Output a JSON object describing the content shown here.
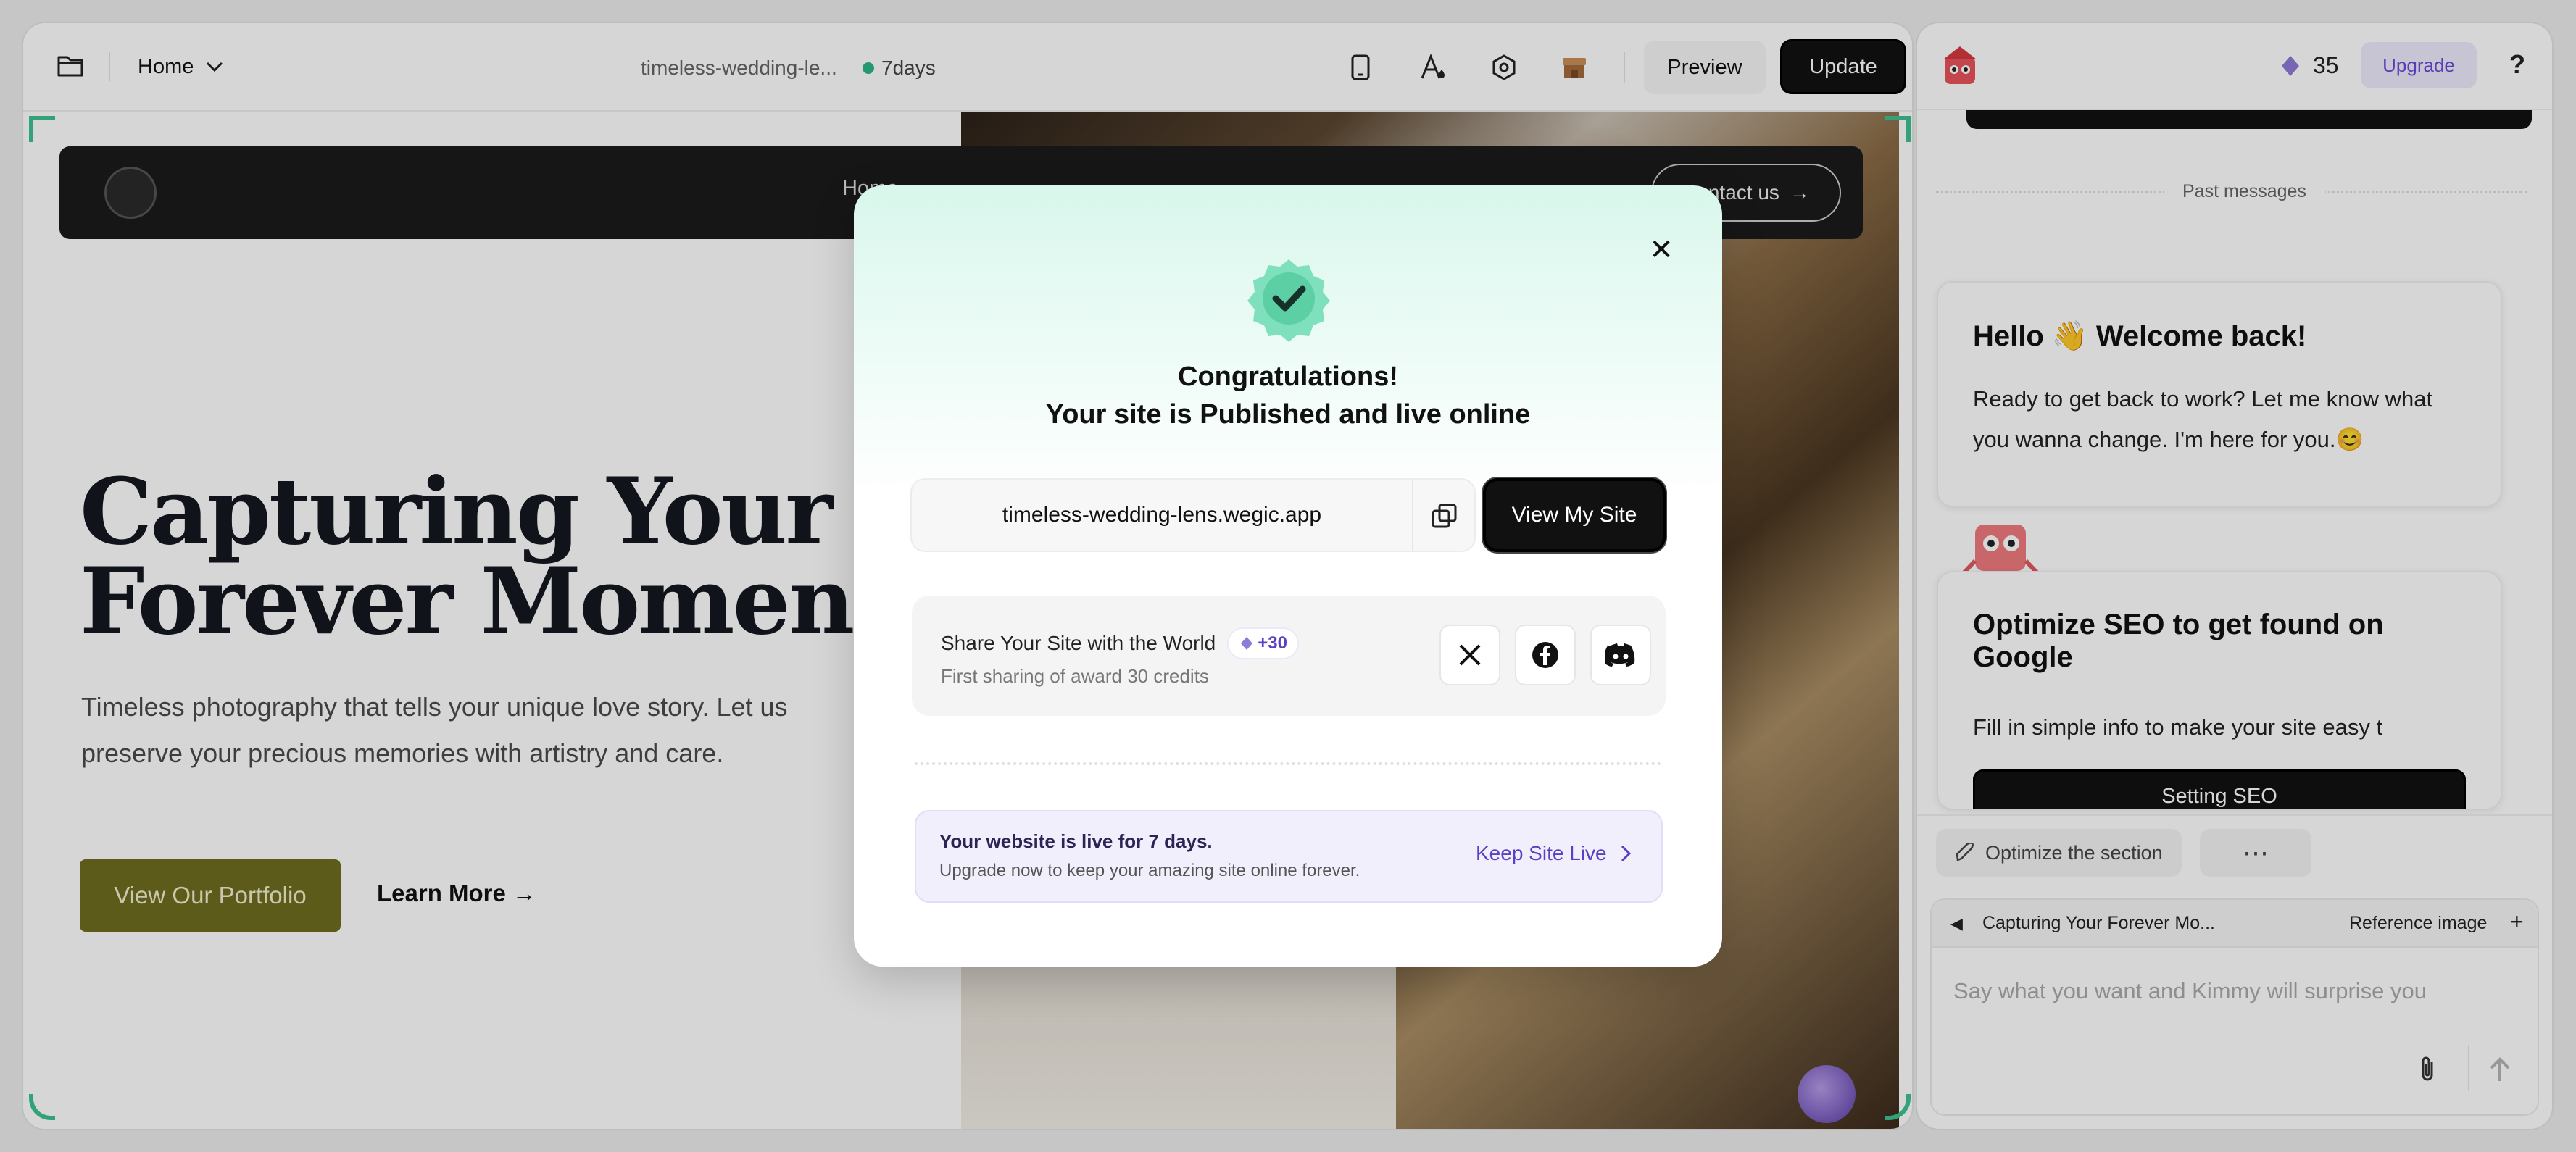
{
  "topbar": {
    "page_select": "Home",
    "site_name": "timeless-wedding-le...",
    "days_left": "7days",
    "preview_label": "Preview",
    "update_label": "Update"
  },
  "site": {
    "nav_home": "Home",
    "nav_contact": "Contact us",
    "hero_title_line1": "Capturing Your",
    "hero_title_line2": "Forever Moments",
    "hero_subtitle": "Timeless photography that tells your unique love story. Let us preserve your precious memories with artistry and care.",
    "portfolio_button": "View Our Portfolio",
    "learn_more": "Learn More →"
  },
  "sidebar": {
    "credits": "35",
    "upgrade_label": "Upgrade",
    "help_label": "?",
    "past_messages": "Past messages",
    "welcome_title": "Hello 👋 Welcome back!",
    "welcome_body": "Ready to get back to work? Let me know what you wanna change. I'm here for you.😊",
    "seo_title": "Optimize SEO to get found on Google",
    "seo_body": "Fill in simple info to make your site easy t",
    "seo_button": "Setting SEO",
    "optimize_label": "Optimize the section",
    "more_label": "⋯",
    "context_section": "Capturing Your Forever Mo...",
    "reference_image": "Reference image",
    "input_placeholder": "Say what you want and Kimmy will surprise you"
  },
  "modal": {
    "title_line1": "Congratulations!",
    "title_line2": "Your site is Published and live online",
    "site_url": "timeless-wedding-lens.wegic.app",
    "view_site": "View My Site",
    "share_title": "Share Your Site with the World",
    "share_badge": "+30",
    "share_sub": "First sharing of award 30 credits",
    "live_title": "Your website is live for 7 days.",
    "live_sub": "Upgrade now to keep your amazing site online forever.",
    "keep_live": "Keep Site Live",
    "close_label": "✕"
  },
  "colors": {
    "accent_green": "#2bb58a",
    "portfolio_olive": "#6f6d1f",
    "upgrade_purple": "#6a4bd6"
  },
  "icons": [
    "folder-icon",
    "chevron-down-icon",
    "mobile-icon",
    "paint-icon",
    "settings-icon",
    "store-icon",
    "close-icon",
    "verified-badge-icon",
    "copy-icon",
    "x-logo-icon",
    "facebook-icon",
    "discord-icon",
    "chevron-right-icon",
    "rocket-icon",
    "attachment-icon",
    "send-icon",
    "diamond-icon"
  ]
}
